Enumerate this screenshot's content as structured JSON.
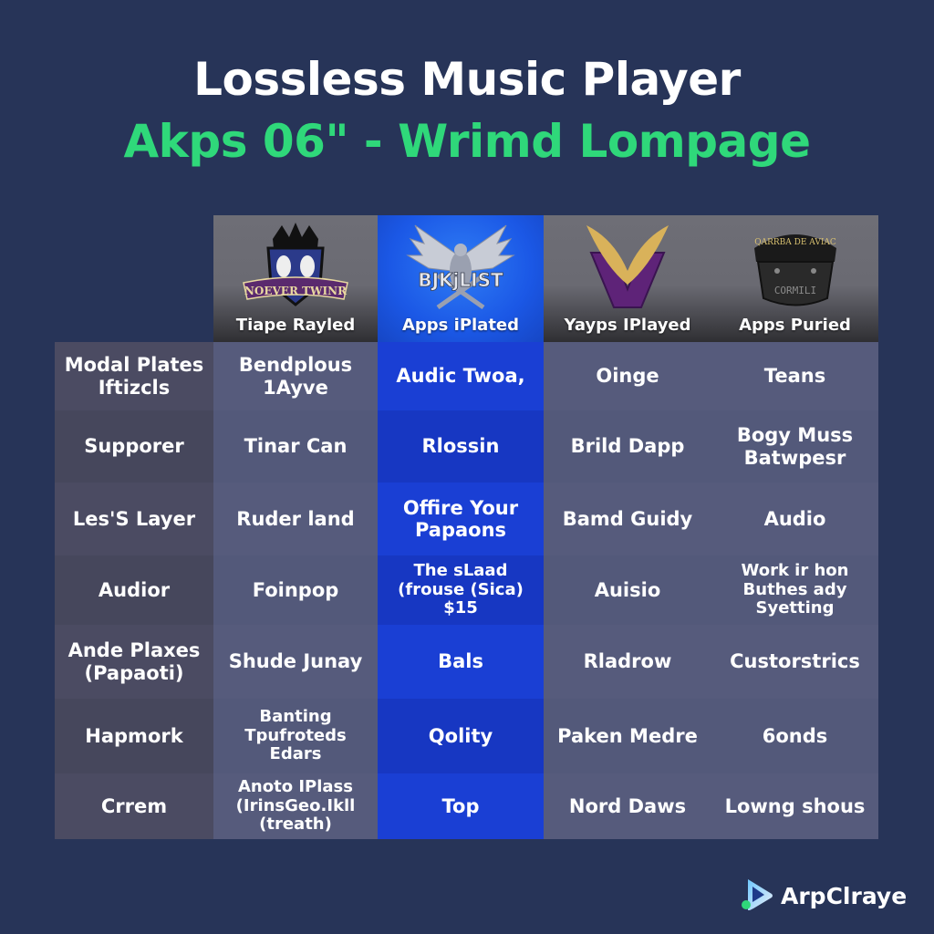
{
  "header": {
    "title": "Lossless Music Player",
    "subtitle": "Akps 06\" - Wrimd Lompage"
  },
  "table": {
    "columns": [
      {
        "label": "Tiape Rayled",
        "logo": "shield-mask-logo",
        "logo_text": "NOEVER TWINR",
        "highlighted": false
      },
      {
        "label": "Apps iPlated",
        "logo": "eagle-logo",
        "logo_text": "BJKjLIST",
        "highlighted": true
      },
      {
        "label": "Yayps IPlayed",
        "logo": "winged-v-logo",
        "logo_text": "",
        "highlighted": false
      },
      {
        "label": "Apps Puried",
        "logo": "helmet-logo",
        "logo_text": "CORMILI",
        "highlighted": false
      }
    ],
    "rows": [
      {
        "label": "Modal Plates\nIftizcls",
        "cells": [
          "Bendplous\n1Ayve",
          "Audic Twoa,",
          "Oinge",
          "Teans"
        ]
      },
      {
        "label": "Supporer",
        "cells": [
          "Tinar Can",
          "Rlossin",
          "Brild Dapp",
          "Bogy Muss\nBatwpesr"
        ]
      },
      {
        "label": "Les'S Layer",
        "cells": [
          "Ruder land",
          "Offire Your\nPapaons",
          "Bamd Guidy",
          "Audio"
        ]
      },
      {
        "label": "Audior",
        "cells": [
          "Foinpop",
          "The sLaad\n(frouse (Sica)\n$15",
          "Auisio",
          "Work ir hon\nButhes ady\nSyetting"
        ]
      },
      {
        "label": "Ande Plaxes\n(Papaoti)",
        "cells": [
          "Shude Junay",
          "Bals",
          "Rladrow",
          "Custorstrics"
        ]
      },
      {
        "label": "Hapmork",
        "cells": [
          "Banting\nTpufroteds\nEdars",
          "Qolity",
          "Paken Medre",
          "6onds"
        ]
      },
      {
        "label": "Crrem",
        "cells": [
          "Anoto IPlass\n(IrinsGeo.Ikll\n(treath)",
          "Top",
          "Nord Daws",
          "Lowng shous"
        ]
      }
    ]
  },
  "brand": {
    "name": "ArpClraye",
    "icon": "play-logo-icon"
  },
  "colors": {
    "background": "#273458",
    "subtitle_green": "#2fd87a",
    "highlight_blue": "#1a3fd4",
    "cell_gray": "#565b7c",
    "label_gray": "#4b4b62"
  }
}
